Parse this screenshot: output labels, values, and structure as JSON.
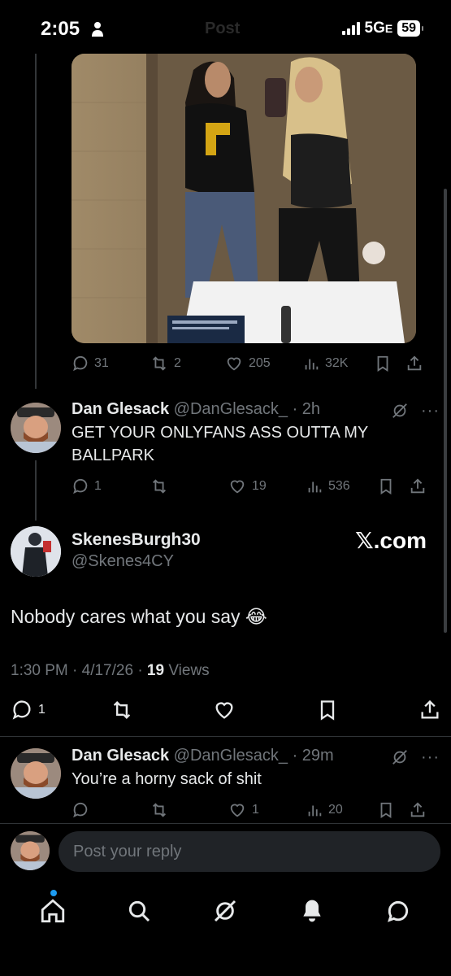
{
  "status_bar": {
    "time": "2:05",
    "title": "Post",
    "network": "5G",
    "network_suffix": "E",
    "battery": "59"
  },
  "post_stats": {
    "replies": "31",
    "reposts": "2",
    "likes": "205",
    "views": "32K"
  },
  "reply1": {
    "name": "Dan Glesack",
    "handle": "@DanGlesack_",
    "time": "· 2h",
    "text": "GET YOUR ONLYFANS ASS OUTTA MY BALLPARK",
    "stats": {
      "replies": "1",
      "reposts": "",
      "likes": "19",
      "views": "536"
    }
  },
  "main_post": {
    "name": "SkenesBurgh30",
    "handle": "@Skenes4CY",
    "badge": "𝕏.com",
    "text": "Nobody cares what you say 😂",
    "meta_time": "1:30 PM · 4/17/26 · ",
    "meta_views_count": "19",
    "meta_views_label": " Views",
    "stats": {
      "replies": "1"
    }
  },
  "reply2": {
    "name": "Dan Glesack",
    "handle": "@DanGlesack_",
    "time": "· 29m",
    "text": "You’re a horny sack of shit",
    "stats": {
      "replies": "",
      "reposts": "",
      "likes": "1",
      "views": "20"
    }
  },
  "composer": {
    "placeholder": "Post your reply"
  },
  "nav": [
    "home-icon",
    "search-icon",
    "grok-icon",
    "notifications-icon",
    "messages-icon"
  ]
}
